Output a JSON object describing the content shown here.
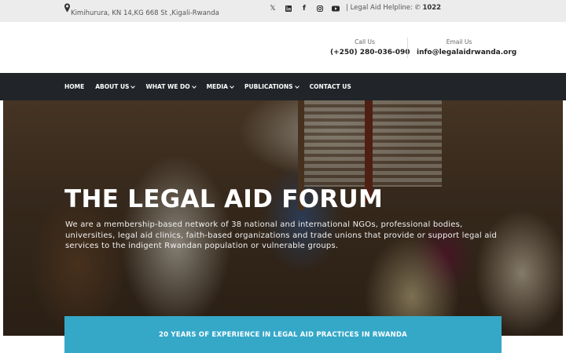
{
  "topbar": {
    "address": "Kimihurura, KN 14,KG 668 St ,Kigali-Rwanda",
    "socials": [
      {
        "icon": "x-twitter-icon",
        "glyph": "𝕏"
      },
      {
        "icon": "linkedin-icon",
        "glyph": "in"
      },
      {
        "icon": "facebook-icon",
        "glyph": "f"
      },
      {
        "icon": "instagram-icon",
        "glyph": "◎"
      },
      {
        "icon": "youtube-icon",
        "glyph": "▶"
      }
    ],
    "helpline_label": "| Legal Aid Helpline:",
    "helpline_number": "1022"
  },
  "header": {
    "call_label": "Call Us",
    "call_value": "(+250) 280-036-090",
    "email_label": "Email Us",
    "email_value": "info@legalaidrwanda.org"
  },
  "nav": {
    "items": [
      {
        "label": "HOME",
        "dropdown": false
      },
      {
        "label": "ABOUT US",
        "dropdown": true
      },
      {
        "label": "WHAT WE DO",
        "dropdown": true
      },
      {
        "label": "MEDIA",
        "dropdown": true
      },
      {
        "label": "PUBLICATIONS",
        "dropdown": true
      },
      {
        "label": "CONTACT US",
        "dropdown": false
      }
    ]
  },
  "hero": {
    "title": "THE LEGAL AID FORUM",
    "description": "We are a membership-based network of 38 national and international NGOs, professional bodies, universities, legal aid clinics, faith-based organizations and trade unions that provide or support legal aid services to the indigent Rwandan population or vulnerable groups."
  },
  "banner": {
    "text": "20 YEARS OF EXPERIENCE IN LEGAL AID PRACTICES IN RWANDA"
  },
  "colors": {
    "topbar_bg": "#ececec",
    "nav_bg": "#212529",
    "accent": "#35a8c8"
  }
}
